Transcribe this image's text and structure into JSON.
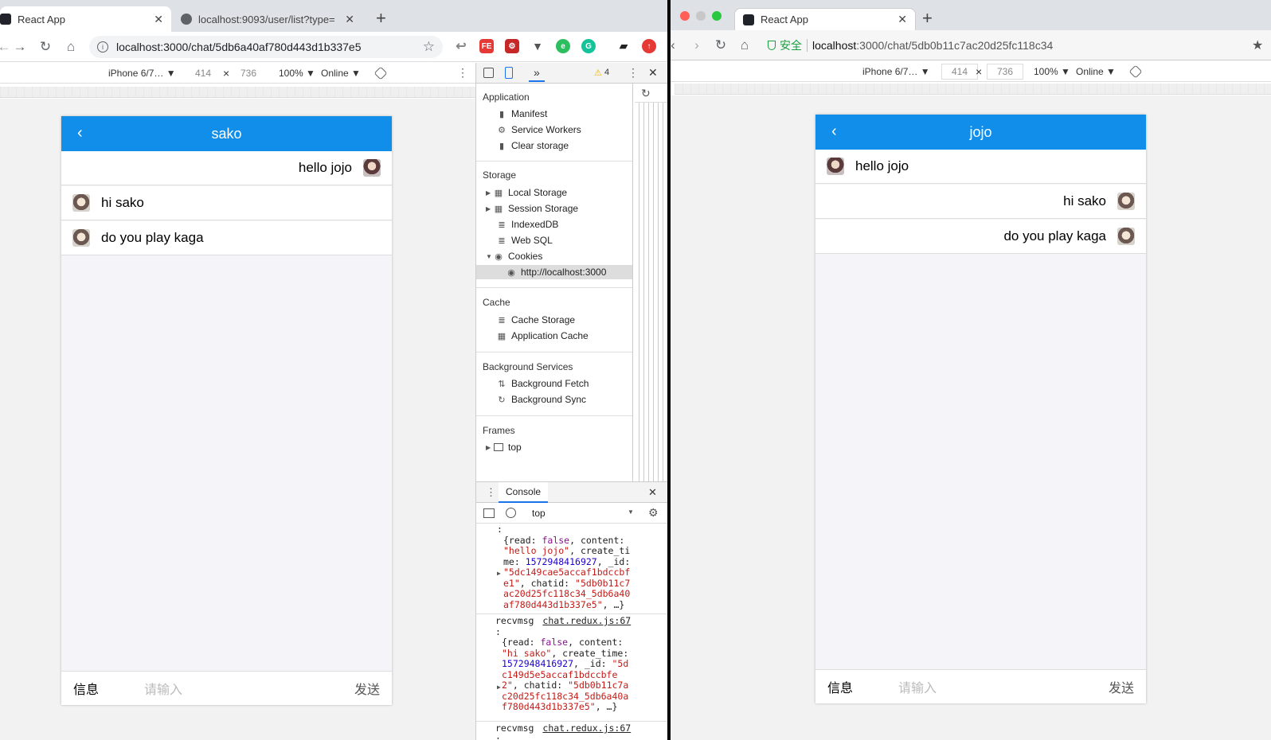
{
  "left": {
    "tabs": [
      {
        "title": "React App",
        "active": true
      },
      {
        "title": "localhost:9093/user/list?type=",
        "active": false
      }
    ],
    "new_tab": "+",
    "url": "localhost:3000/chat/5db6a40af780d443d1b337e5",
    "device_bar": {
      "device": "iPhone 6/7… ▼",
      "width": "414",
      "x": "×",
      "height": "736",
      "zoom": "100% ▼",
      "network": "Online ▼"
    },
    "devtools": {
      "warn_count": "4",
      "sections": [
        {
          "title": "Application",
          "items": [
            "Manifest",
            "Service Workers",
            "Clear storage"
          ]
        },
        {
          "title": "Storage",
          "items": [
            "Local Storage",
            "Session Storage",
            "IndexedDB",
            "Web SQL",
            "Cookies",
            "http://localhost:3000"
          ]
        },
        {
          "title": "Cache",
          "items": [
            "Cache Storage",
            "Application Cache"
          ]
        },
        {
          "title": "Background Services",
          "items": [
            "Background Fetch",
            "Background Sync"
          ]
        },
        {
          "title": "Frames",
          "items": [
            "top"
          ]
        }
      ],
      "console_tab": "Console",
      "console_context": "top",
      "log_source": "chat.redux.js:67",
      "log_label": "recvmsg"
    },
    "chat": {
      "title": "sako",
      "messages": [
        {
          "text": "hello jojo",
          "side": "right"
        },
        {
          "text": "hi sako",
          "side": "left"
        },
        {
          "text": "do you play kaga",
          "side": "left"
        }
      ],
      "footer_label": "信息",
      "placeholder": "请输入",
      "send": "发送"
    }
  },
  "right": {
    "tab": "React App",
    "new_tab": "+",
    "secure": "安全",
    "url_host": "localhost",
    "url_rest": ":3000/chat/5db0b11c7ac20d25fc118c34",
    "device_bar": {
      "device": "iPhone 6/7… ▼",
      "width": "414",
      "x": "×",
      "height": "736",
      "zoom": "100% ▼",
      "network": "Online ▼"
    },
    "chat": {
      "title": "jojo",
      "messages": [
        {
          "text": "hello jojo",
          "side": "left"
        },
        {
          "text": "hi sako",
          "side": "right"
        },
        {
          "text": "do you play kaga",
          "side": "right"
        }
      ],
      "footer_label": "信息",
      "placeholder": "请输入",
      "send": "发送"
    }
  },
  "colors": {
    "header_blue": "#108ee9",
    "warning": "#f4b400"
  }
}
